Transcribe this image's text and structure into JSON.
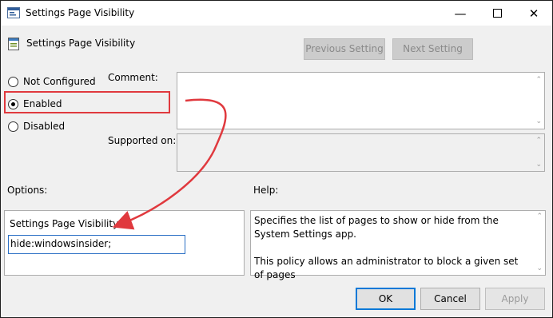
{
  "window": {
    "title": "Settings Page Visibility",
    "minimize_icon": "minimize-icon",
    "maximize_icon": "maximize-icon",
    "close_icon": "close-icon"
  },
  "header": {
    "policy_title": "Settings Page Visibility",
    "previous_setting": "Previous Setting",
    "next_setting": "Next Setting"
  },
  "state": {
    "not_configured": "Not Configured",
    "enabled": "Enabled",
    "disabled": "Disabled",
    "selected": "enabled"
  },
  "comment": {
    "label": "Comment:",
    "value": ""
  },
  "supported_on": {
    "label": "Supported on:",
    "value": ""
  },
  "options": {
    "heading": "Options:",
    "field_label": "Settings Page Visibility:",
    "field_value": "hide:windowsinsider;"
  },
  "help": {
    "heading": "Help:",
    "paragraph1": "Specifies the list of pages to show or hide from the System Settings app.",
    "paragraph2": "This policy allows an administrator to block a given set of pages"
  },
  "buttons": {
    "ok": "OK",
    "cancel": "Cancel",
    "apply": "Apply"
  },
  "colors": {
    "annotation": "#e0393e",
    "focus": "#0078d7"
  }
}
